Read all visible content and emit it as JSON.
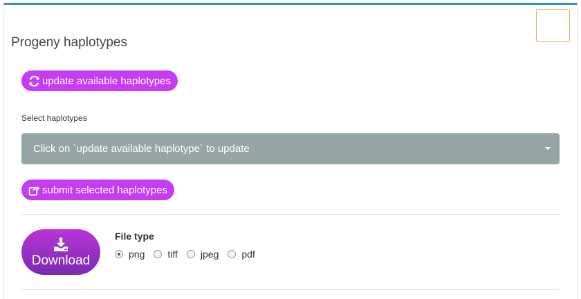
{
  "panel": {
    "title": "Progeny haplotypes"
  },
  "update_button": {
    "label": "update available haplotypes",
    "icon": "refresh-icon"
  },
  "select": {
    "label": "Select haplotypes",
    "value": "Click on `update available haplotype` to update"
  },
  "submit_button": {
    "label": "submit selected haplotypes",
    "icon": "share-square-icon"
  },
  "download": {
    "label": "Download",
    "icon": "download-icon"
  },
  "file_type": {
    "label": "File type",
    "options": [
      "png",
      "tiff",
      "jpeg",
      "pdf"
    ],
    "selected": "png"
  },
  "colors": {
    "accent_border": "#3c8dbc",
    "button_purple": "#c63cf0",
    "select_bg": "#95a5a6",
    "corner_box_border": "#f0ad4e"
  }
}
